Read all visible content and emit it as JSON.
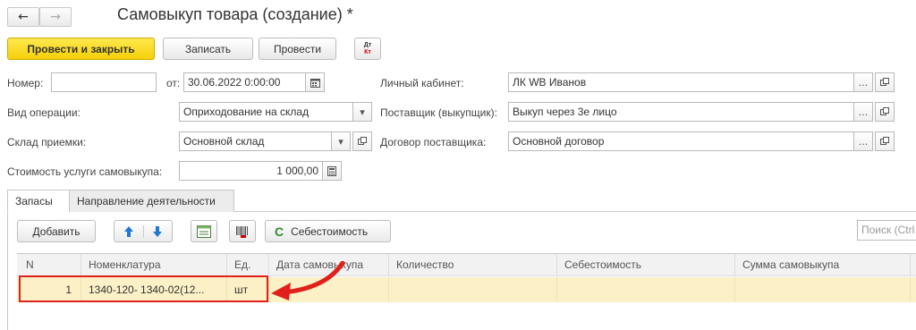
{
  "nav": {
    "back_glyph": "←",
    "forward_glyph": "→"
  },
  "title": "Самовыкуп товара (создание) *",
  "toolbar": {
    "post_close": "Провести и закрыть",
    "save": "Записать",
    "post": "Провести",
    "dtkt_top": "Дт",
    "dtkt_bottom": "Кт"
  },
  "form": {
    "number_label": "Номер:",
    "number_value": "",
    "from_label": "от:",
    "date_value": "30.06.2022  0:00:00",
    "cabinet_label": "Личный кабинет:",
    "cabinet_value": "ЛК WB Иванов",
    "op_label": "Вид операции:",
    "op_value": "Оприходование на склад",
    "supplier_label": "Поставщик (выкупщик):",
    "supplier_value": "Выкуп через 3е лицо",
    "warehouse_label": "Склад приемки:",
    "warehouse_value": "Основной склад",
    "contract_label": "Договор поставщика:",
    "contract_value": "Основной договор",
    "cost_label": "Стоимость услуги самовыкупа:",
    "cost_value": "1 000,00"
  },
  "tabs": [
    {
      "label": "Запасы"
    },
    {
      "label": "Направление деятельности"
    }
  ],
  "table_toolbar": {
    "add": "Добавить",
    "cost_button": "Себестоимость",
    "search_placeholder": "Поиск (Ctrl"
  },
  "table": {
    "columns": [
      "N",
      "Номенклатура",
      "Ед.",
      "Дата самовыкупа",
      "Количество",
      "Себестоимость",
      "Сумма самовыкупа"
    ],
    "rows": [
      {
        "n": "1",
        "item": "1340-120- 1340-02(12...",
        "unit": "шт",
        "date": "",
        "qty": "",
        "cost": "",
        "sum": ""
      }
    ]
  },
  "annotation": {
    "highlight_color": "#e0201b"
  },
  "icons": {
    "ellipsis": "...",
    "open": "open-icon",
    "calendar": "calendar-icon",
    "calculator": "calculator-icon",
    "dropdown": "▾",
    "up": "arrow-up-icon",
    "down": "arrow-down-icon",
    "refresh": "C"
  }
}
